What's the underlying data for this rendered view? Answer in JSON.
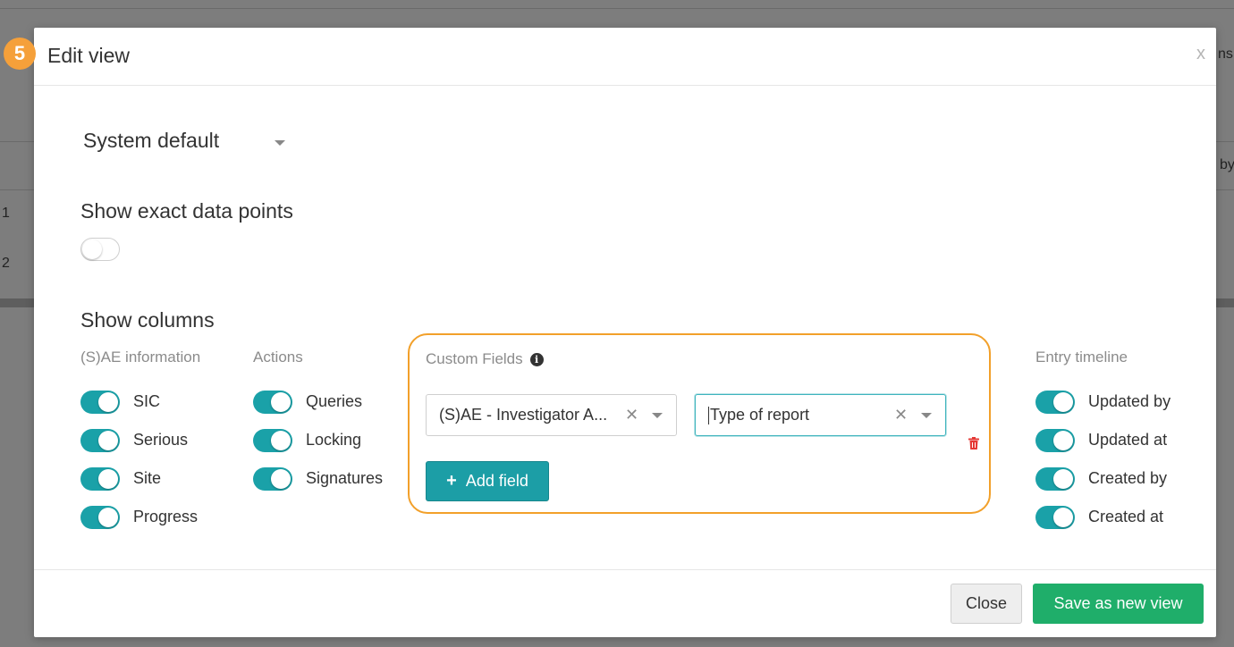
{
  "background": {
    "text_right_top": "ns",
    "text_right_mid": "by",
    "row_numbers": [
      "1",
      "2"
    ]
  },
  "step_badge": "5",
  "modal": {
    "title": "Edit view",
    "close_glyph": "x",
    "view_select": {
      "value": "System default"
    },
    "exact_points": {
      "label": "Show exact data points",
      "enabled": false
    },
    "show_columns": {
      "title": "Show columns",
      "sae": {
        "header": "(S)AE information",
        "items": [
          {
            "label": "SIC",
            "on": true
          },
          {
            "label": "Serious",
            "on": true
          },
          {
            "label": "Site",
            "on": true
          },
          {
            "label": "Progress",
            "on": true
          }
        ]
      },
      "actions": {
        "header": "Actions",
        "items": [
          {
            "label": "Queries",
            "on": true
          },
          {
            "label": "Locking",
            "on": true
          },
          {
            "label": "Signatures",
            "on": true
          }
        ]
      },
      "custom_fields": {
        "header": "Custom Fields",
        "field_1": "(S)AE - Investigator A...",
        "field_2": "Type of report",
        "add_label": "Add field"
      },
      "timeline": {
        "header": "Entry timeline",
        "items": [
          {
            "label": "Updated by",
            "on": true
          },
          {
            "label": "Updated at",
            "on": true
          },
          {
            "label": "Created by",
            "on": true
          },
          {
            "label": "Created at",
            "on": true
          }
        ]
      }
    },
    "footer": {
      "close_label": "Close",
      "save_label": "Save as new view"
    }
  },
  "colors": {
    "accent": "#1aa1a8",
    "save": "#1fae6a",
    "highlight": "#f2a02a",
    "danger": "#e53935"
  }
}
